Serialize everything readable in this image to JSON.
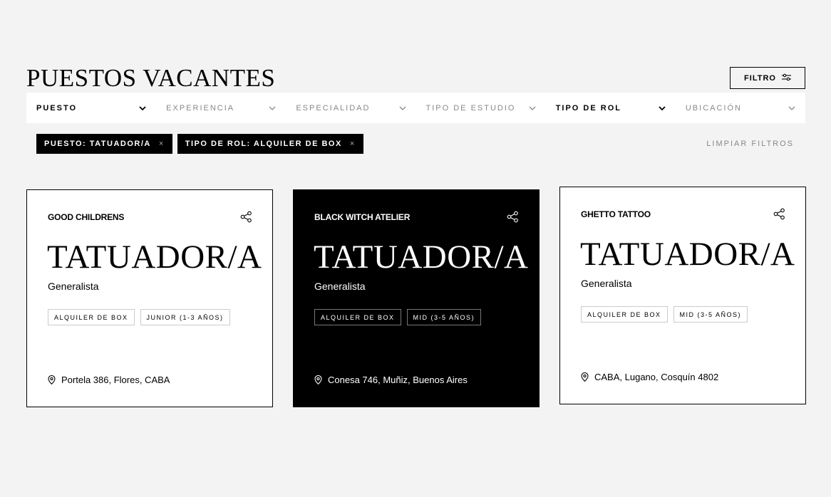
{
  "page": {
    "title": "PUESTOS VACANTES",
    "filter_button_label": "FILTRO"
  },
  "filters": [
    {
      "label": "PUESTO",
      "active": true
    },
    {
      "label": "EXPERIENCIA",
      "active": false
    },
    {
      "label": "ESPECIALIDAD",
      "active": false
    },
    {
      "label": "TIPO DE ESTUDIO",
      "active": false
    },
    {
      "label": "TIPO DE ROL",
      "active": true
    },
    {
      "label": "UBICACIÓN",
      "active": false
    }
  ],
  "active_filters": [
    {
      "label": "PUESTO: TATUADOR/A",
      "remove": "×"
    },
    {
      "label": "TIPO DE ROL: ALQUILER DE BOX",
      "remove": "×"
    }
  ],
  "clear_filters_label": "LIMPIAR FILTROS",
  "cards": [
    {
      "company": "GOOD CHILDRENS",
      "title": "TATUADOR/A",
      "specialty": "Generalista",
      "tags": [
        "ALQUILER DE BOX",
        "JUNIOR (1-3 AÑOS)"
      ],
      "location": "Portela 386, Flores, CABA",
      "theme": "light"
    },
    {
      "company": "BLACK WITCH ATELIER",
      "title": "TATUADOR/A",
      "specialty": "Generalista",
      "tags": [
        "ALQUILER DE BOX",
        "MID (3-5 AÑOS)"
      ],
      "location": "Conesa 746, Muñiz, Buenos Aires",
      "theme": "dark"
    },
    {
      "company": "GHETTO TATTOO",
      "title": "TATUADOR/A",
      "specialty": "Generalista",
      "tags": [
        "ALQUILER DE BOX",
        "MID (3-5 AÑOS)"
      ],
      "location": "CABA, Lugano, Cosquín 4802",
      "theme": "light"
    }
  ],
  "icons": {
    "filter": "sliders-icon",
    "dropdown": "chevron-down-icon",
    "remove": "close-icon",
    "share": "share-icon",
    "location": "location-pin-icon"
  },
  "colors": {
    "background": "#f3f3f3",
    "card_light": "#ffffff",
    "card_dark": "#000000",
    "chip": "#000000",
    "muted_text": "#888888"
  }
}
